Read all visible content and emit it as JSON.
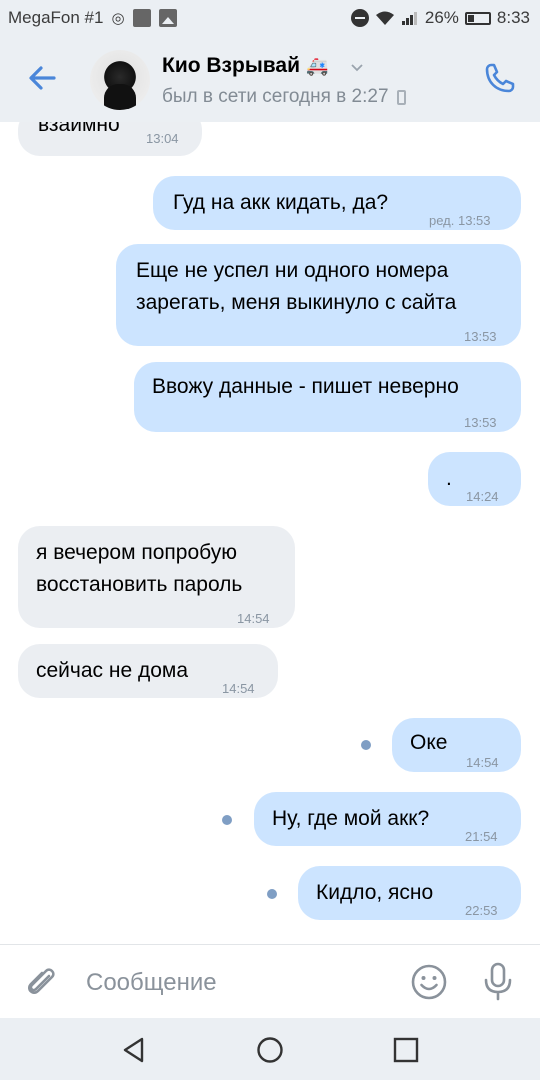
{
  "statusbar": {
    "carrier": "MegaFon #1",
    "battery": "26%",
    "time": "8:33"
  },
  "header": {
    "name": "Кио Взрывай",
    "name_emoji": "🚑",
    "last_seen": "был в сети сегодня в 2:27"
  },
  "messages": [
    {
      "dir": "in",
      "text": "взаимно",
      "time": "13:04"
    },
    {
      "dir": "out",
      "text": "Гуд на акк кидать, да?",
      "time": "ред. 13:53"
    },
    {
      "dir": "out",
      "line1": "Еще не успел ни одного номера",
      "line2": "зарегать, меня выкинуло с сайта",
      "time": "13:53"
    },
    {
      "dir": "out",
      "text": "Ввожу данные - пишет неверно",
      "time": "13:53"
    },
    {
      "dir": "out",
      "text": ".",
      "time": "14:24"
    },
    {
      "dir": "in",
      "line1": "я вечером попробую",
      "line2": "восстановить пароль",
      "time": "14:54"
    },
    {
      "dir": "in",
      "text": "сейчас не дома",
      "time": "14:54"
    },
    {
      "dir": "out",
      "text": "Оке",
      "time": "14:54",
      "unread": true
    },
    {
      "dir": "out",
      "text": "Ну, где мой акк?",
      "time": "21:54",
      "unread": true
    },
    {
      "dir": "out",
      "text": "Кидло, ясно",
      "time": "22:53",
      "unread": true
    }
  ],
  "composer": {
    "placeholder": "Сообщение"
  },
  "colors": {
    "accent": "#4a86d9",
    "incoming": "#ebeef2",
    "outgoing": "#cce4ff",
    "bars": "#ebeff3"
  }
}
